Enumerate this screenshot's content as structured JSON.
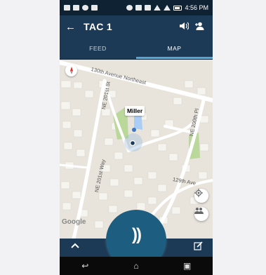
{
  "status_bar": {
    "time": "4:56 PM"
  },
  "app_bar": {
    "back_icon": "arrow-left-icon",
    "title": "TAC 1",
    "speaker_icon": "speaker-icon",
    "contacts_icon": "person-add-icon"
  },
  "tabs": [
    {
      "label": "FEED",
      "active": false
    },
    {
      "label": "MAP",
      "active": true
    }
  ],
  "map": {
    "user_label": "Miller",
    "streets": {
      "s130": "130th Avenue Northeast",
      "s201st": "NE 201st St",
      "s201way": "NE 201st Way",
      "s200pl": "NE 200th Pl",
      "s129": "129th Ave"
    },
    "attribution": "Google",
    "colors": {
      "park": "#b9d89a",
      "water": "#aacdf5",
      "road": "#ffffff",
      "block": "#f7f5f0"
    }
  },
  "bottom_bar": {
    "expand_icon": "chevron-up-icon",
    "ptt_icon": "push-to-talk-icon",
    "ptt_glyph": "))",
    "edit_icon": "edit-icon",
    "ptt_color": "#1c5d80"
  },
  "nav": {
    "back": "↩",
    "home": "⌂",
    "recents": "▣"
  }
}
